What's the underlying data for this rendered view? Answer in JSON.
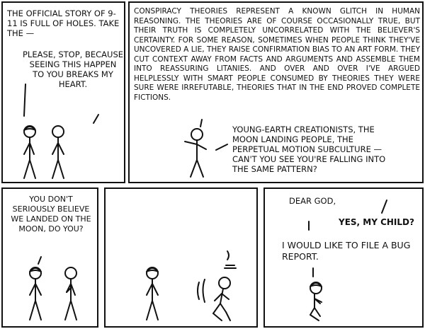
{
  "panels": [
    {
      "caption_1": "The official story of 9-11 is full of holes. Take the —",
      "caption_2": "Please, stop, because seeing this happen to you breaks my heart."
    },
    {
      "caption_1": "Conspiracy theories represent a known glitch in human reasoning. The theories are of course occasionally true, but their truth is completely uncorrelated with the believer's certainty. For some reason, sometimes when people think they've uncovered a lie, they raise confirmation bias to an art form. They cut context away from facts and arguments and assemble them into reassuring litanies. And over and over I've argued helplessly with smart people consumed by theories they were sure were irrefutable, theories that in the end proved complete fictions.",
      "caption_2": "Young-earth creationists, the moon landing people, the perpetual motion subculture — can't you see you're falling into the same pattern?"
    },
    {
      "caption_1": "You don't seriously believe we landed on the moon, do you?"
    },
    {
      "caption_1": ""
    },
    {
      "caption_1": "Dear God,",
      "caption_2": "Yes, my child?",
      "caption_3": "I would like to file a bug report."
    }
  ]
}
